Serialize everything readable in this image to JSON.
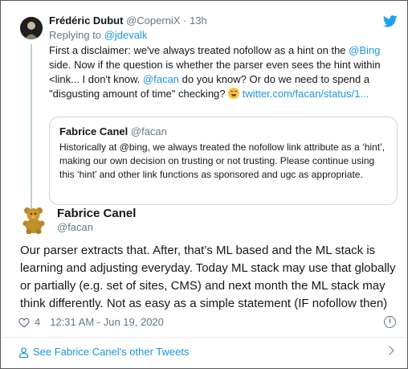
{
  "reply_tweet": {
    "author_name": "Frédéric Dubut",
    "author_handle": "@CoperniX",
    "separator": "·",
    "time": "13h",
    "replying_prefix": "Replying to ",
    "replying_handle": "@jdevalk",
    "text_part1": "First a disclaimer: we've always treated nofollow as a hint on the ",
    "mention_bing": "@Bing",
    "text_part2": " side. Now if the question is whether the parser even sees the hint within <link... I don't know. ",
    "mention_facan": "@facan",
    "text_part3": " do you know? Or do we need to spend a \"disgusting amount of time\" checking? ",
    "emoji_icon": "grinning-squinting-face-icon",
    "link_text": "twitter.com/facan/status/1..."
  },
  "quoted_tweet": {
    "author_name": "Fabrice Canel",
    "author_handle": "@facan",
    "text": "Historically at @bing, we always treated the nofollow link attribute as a ‘hint’, making our own decision on trusting or not trusting. Please continue using this ‘hint’ and other link functions as sponsored and ugc as appropriate."
  },
  "main_tweet": {
    "author_name": "Fabrice Canel",
    "author_handle": "@facan",
    "text": "Our parser extracts that. After, that’s ML based and the ML stack is learning and adjusting everyday. Today ML stack may use that globally or partially (e.g. set of sites, CMS) and next month the ML stack may think differently. Not as easy as a simple statement (IF nofollow then)",
    "like_count": "4",
    "timestamp": "12:31 AM - Jun 19, 2020",
    "info_icon_glyph": "i"
  },
  "footer": {
    "see_more": "See Fabrice Canel's other Tweets"
  },
  "colors": {
    "link": "#1b95e0",
    "muted": "#657786",
    "text": "#14171a"
  }
}
